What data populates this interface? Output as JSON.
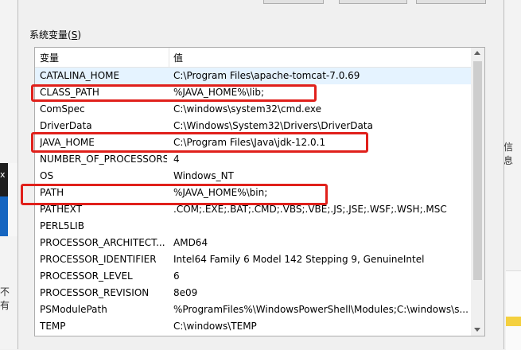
{
  "section": {
    "label": "系统变量",
    "accel": "S"
  },
  "columns": {
    "name": "变量",
    "value": "值"
  },
  "rows": [
    {
      "name": "CATALINA_HOME",
      "value": "C:\\Program Files\\apache-tomcat-7.0.69",
      "selected": true
    },
    {
      "name": "CLASS_PATH",
      "value": "%JAVA_HOME%\\lib;"
    },
    {
      "name": "ComSpec",
      "value": "C:\\windows\\system32\\cmd.exe"
    },
    {
      "name": "DriverData",
      "value": "C:\\Windows\\System32\\Drivers\\DriverData"
    },
    {
      "name": "JAVA_HOME",
      "value": "C:\\Program Files\\Java\\jdk-12.0.1"
    },
    {
      "name": "NUMBER_OF_PROCESSORS",
      "value": "4"
    },
    {
      "name": "OS",
      "value": "Windows_NT"
    },
    {
      "name": "PATH",
      "value": "%JAVA_HOME%\\bin;"
    },
    {
      "name": "PATHEXT",
      "value": ".COM;.EXE;.BAT;.CMD;.VBS;.VBE;.JS;.JSE;.WSF;.WSH;.MSC"
    },
    {
      "name": "PERL5LIB",
      "value": ""
    },
    {
      "name": "PROCESSOR_ARCHITECT...",
      "value": "AMD64"
    },
    {
      "name": "PROCESSOR_IDENTIFIER",
      "value": "Intel64 Family 6 Model 142 Stepping 9, GenuineIntel"
    },
    {
      "name": "PROCESSOR_LEVEL",
      "value": "6"
    },
    {
      "name": "PROCESSOR_REVISION",
      "value": "8e09"
    },
    {
      "name": "PSModulePath",
      "value": "%ProgramFiles%\\WindowsPowerShell\\Modules;C:\\windows\\s..."
    },
    {
      "name": "TEMP",
      "value": "C:\\windows\\TEMP"
    }
  ],
  "background": {
    "left_close": "x",
    "left_char": "不有",
    "right_char": "信息"
  },
  "colors": {
    "highlight": "#e0201b",
    "selected": "#e5f3ff"
  }
}
